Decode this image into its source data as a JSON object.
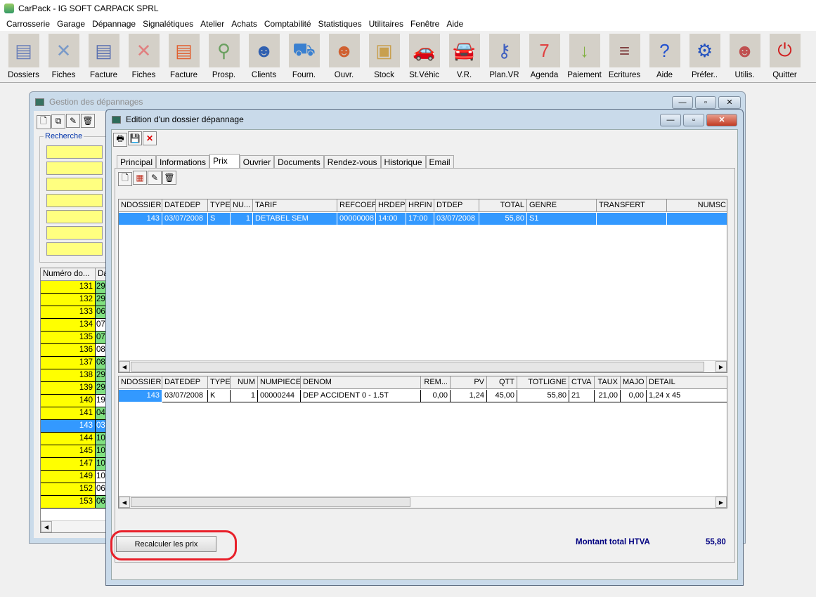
{
  "app": {
    "title": "CarPack - IG SOFT CARPACK SPRL"
  },
  "menu": [
    "Carrosserie",
    "Garage",
    "Dépannage",
    "Signalétiques",
    "Atelier",
    "Achats",
    "Comptabilité",
    "Statistiques",
    "Utilitaires",
    "Fenêtre",
    "Aide"
  ],
  "toolbar": [
    {
      "label": "Dossiers",
      "icon": "folder-icon",
      "color": "#6a7fb8"
    },
    {
      "label": "Fiches",
      "icon": "tools-icon",
      "color": "#7a9ac8"
    },
    {
      "label": "Facture",
      "icon": "folder-add-icon",
      "color": "#5a70b0"
    },
    {
      "label": "Fiches",
      "icon": "tools-red-icon",
      "color": "#e08080"
    },
    {
      "label": "Facture",
      "icon": "invoice-add-icon",
      "color": "#e06030"
    },
    {
      "label": "Prosp.",
      "icon": "prospect-search-icon",
      "color": "#6aa060"
    },
    {
      "label": "Clients",
      "icon": "client-icon",
      "color": "#3060b0"
    },
    {
      "label": "Fourn.",
      "icon": "truck-icon",
      "color": "#3a80d0"
    },
    {
      "label": "Ouvr.",
      "icon": "workers-icon",
      "color": "#d06030"
    },
    {
      "label": "Stock",
      "icon": "boxes-icon",
      "color": "#c8a050"
    },
    {
      "label": "St.Véhic",
      "icon": "cars-icon",
      "color": "#e06020"
    },
    {
      "label": "V.R.",
      "icon": "car-keys-icon",
      "color": "#a0a0a0"
    },
    {
      "label": "Plan.VR",
      "icon": "keys-icon",
      "color": "#4060c0"
    },
    {
      "label": "Agenda",
      "icon": "calendar-icon",
      "color": "#e04040"
    },
    {
      "label": "Paiement",
      "icon": "payment-icon",
      "color": "#80b040"
    },
    {
      "label": "Ecritures",
      "icon": "books-icon",
      "color": "#804040"
    },
    {
      "label": "Aide",
      "icon": "help-icon",
      "color": "#2050d0"
    },
    {
      "label": "Préfer..",
      "icon": "gear-icon",
      "color": "#2050c0"
    },
    {
      "label": "Utilis.",
      "icon": "users-icon",
      "color": "#c05050"
    },
    {
      "label": "Quitter",
      "icon": "power-icon",
      "color": "#d02020"
    }
  ],
  "back_window": {
    "title": "Gestion des dépannages",
    "search_label": "Recherche",
    "list_header": [
      "Numéro do...",
      "Da"
    ],
    "rows": [
      {
        "num": "131",
        "d": "29",
        "s": "green"
      },
      {
        "num": "132",
        "d": "29",
        "s": "green"
      },
      {
        "num": "133",
        "d": "06",
        "s": "green"
      },
      {
        "num": "134",
        "d": "07",
        "s": "white"
      },
      {
        "num": "135",
        "d": "07",
        "s": "green"
      },
      {
        "num": "136",
        "d": "08",
        "s": "white"
      },
      {
        "num": "137",
        "d": "08",
        "s": "green"
      },
      {
        "num": "138",
        "d": "29",
        "s": "green"
      },
      {
        "num": "139",
        "d": "29",
        "s": "green"
      },
      {
        "num": "140",
        "d": "19",
        "s": "white"
      },
      {
        "num": "141",
        "d": "04",
        "s": "green"
      },
      {
        "num": "143",
        "d": "03",
        "s": "selected"
      },
      {
        "num": "144",
        "d": "10",
        "s": "green"
      },
      {
        "num": "145",
        "d": "10",
        "s": "green"
      },
      {
        "num": "147",
        "d": "10",
        "s": "green"
      },
      {
        "num": "149",
        "d": "10",
        "s": "white"
      },
      {
        "num": "152",
        "d": "06",
        "s": "white"
      },
      {
        "num": "153",
        "d": "06",
        "s": "green"
      }
    ]
  },
  "edit_window": {
    "title": "Edition d'un dossier dépannage",
    "tabs": [
      "Principal",
      "Informations",
      "Prix",
      "Ouvrier",
      "Documents",
      "Rendez-vous",
      "Historique",
      "Email"
    ],
    "active_tab": "Prix",
    "grid1": {
      "columns": [
        "NDOSSIER",
        "DATEDEP",
        "TYPE",
        "NU...",
        "TARIF",
        "REFCOEF",
        "HRDEP",
        "HRFIN",
        "DTDEP",
        "TOTAL",
        "GENRE",
        "TRANSFERT",
        "NUMSC"
      ],
      "rows": [
        [
          "143",
          "03/07/2008",
          "S",
          "1",
          "DETABEL SEM",
          "00000008",
          "14:00",
          "17:00",
          "03/07/2008",
          "55,80",
          "S1",
          "",
          ""
        ]
      ]
    },
    "grid2": {
      "columns": [
        "NDOSSIER",
        "DATEDEP",
        "TYPE",
        "NUM",
        "NUMPIECE",
        "DENOM",
        "REM...",
        "PV",
        "QTT",
        "TOTLIGNE",
        "CTVA",
        "TAUX",
        "MAJO",
        "DETAIL"
      ],
      "rows": [
        [
          "143",
          "03/07/2008",
          "K",
          "1",
          "00000244",
          "DEP ACCIDENT 0 - 1.5T",
          "0,00",
          "1,24",
          "45,00",
          "55,80",
          "21",
          "21,00",
          "0,00",
          "1,24 x 45"
        ]
      ]
    },
    "recalc_label": "Recalculer les prix",
    "total_label": "Montant total HTVA",
    "total_value": "55,80"
  },
  "colors": {
    "selection": "#3399ff",
    "highlight": "#e8202a",
    "total_text": "#000080",
    "yellow": "#ffff00",
    "green": "#80e080"
  }
}
